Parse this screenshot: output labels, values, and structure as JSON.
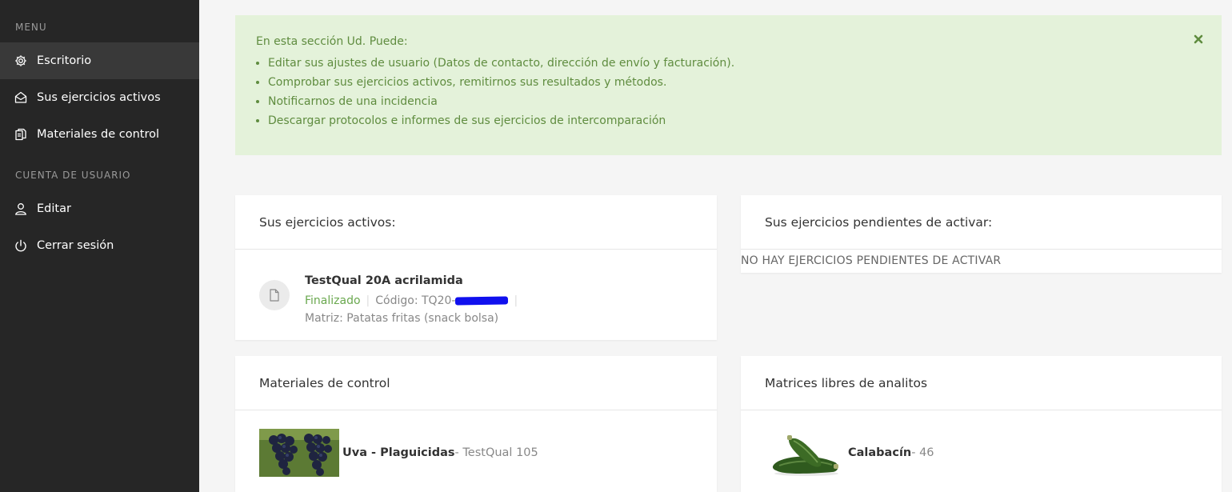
{
  "sidebar": {
    "menu_title": "MENU",
    "account_title": "CUENTA DE USUARIO",
    "items": [
      {
        "label": "Escritorio",
        "icon": "gear-icon",
        "active": true
      },
      {
        "label": "Sus ejercicios activos",
        "icon": "envelope-open-icon"
      },
      {
        "label": "Materiales de control",
        "icon": "copy-icon"
      },
      {
        "label": "Editar",
        "icon": "user-icon"
      },
      {
        "label": "Cerrar sesión",
        "icon": "power-icon"
      }
    ]
  },
  "alert": {
    "intro": "En esta sección Ud. Puede:",
    "items": [
      "Editar sus ajustes de usuario (Datos de contacto, dirección de envío y facturación).",
      "Comprobar sus ejercicios activos, remitirnos sus resultados y métodos.",
      "Notificarnos de una incidencia",
      "Descargar protocolos e informes de sus ejercicios de intercomparación"
    ],
    "close_icon": "close-icon"
  },
  "active_exercises": {
    "title": "Sus ejercicios activos:",
    "exercise": {
      "name": "TestQual 20A acrilamida",
      "status": "Finalizado",
      "code_prefix": "Código: TQ20-",
      "matrix": "Matriz: Patatas fritas (snack bolsa)",
      "icon": "file-icon"
    }
  },
  "pending_exercises": {
    "title": "Sus ejercicios pendientes de activar:",
    "empty": "NO HAY EJERCICIOS PENDIENTES DE ACTIVAR"
  },
  "control_materials": {
    "title": "Materiales de control",
    "item": {
      "name": "Uva - Plaguicidas",
      "meta": " - TestQual 105"
    }
  },
  "free_matrices": {
    "title": "Matrices libres de analitos",
    "item": {
      "name": "Calabacín",
      "meta": " - 46"
    }
  },
  "colors": {
    "sidebar_bg": "#262626",
    "alert_bg": "#e4f2da",
    "alert_text": "#5f8c3f",
    "status_green": "#6aa84f"
  }
}
